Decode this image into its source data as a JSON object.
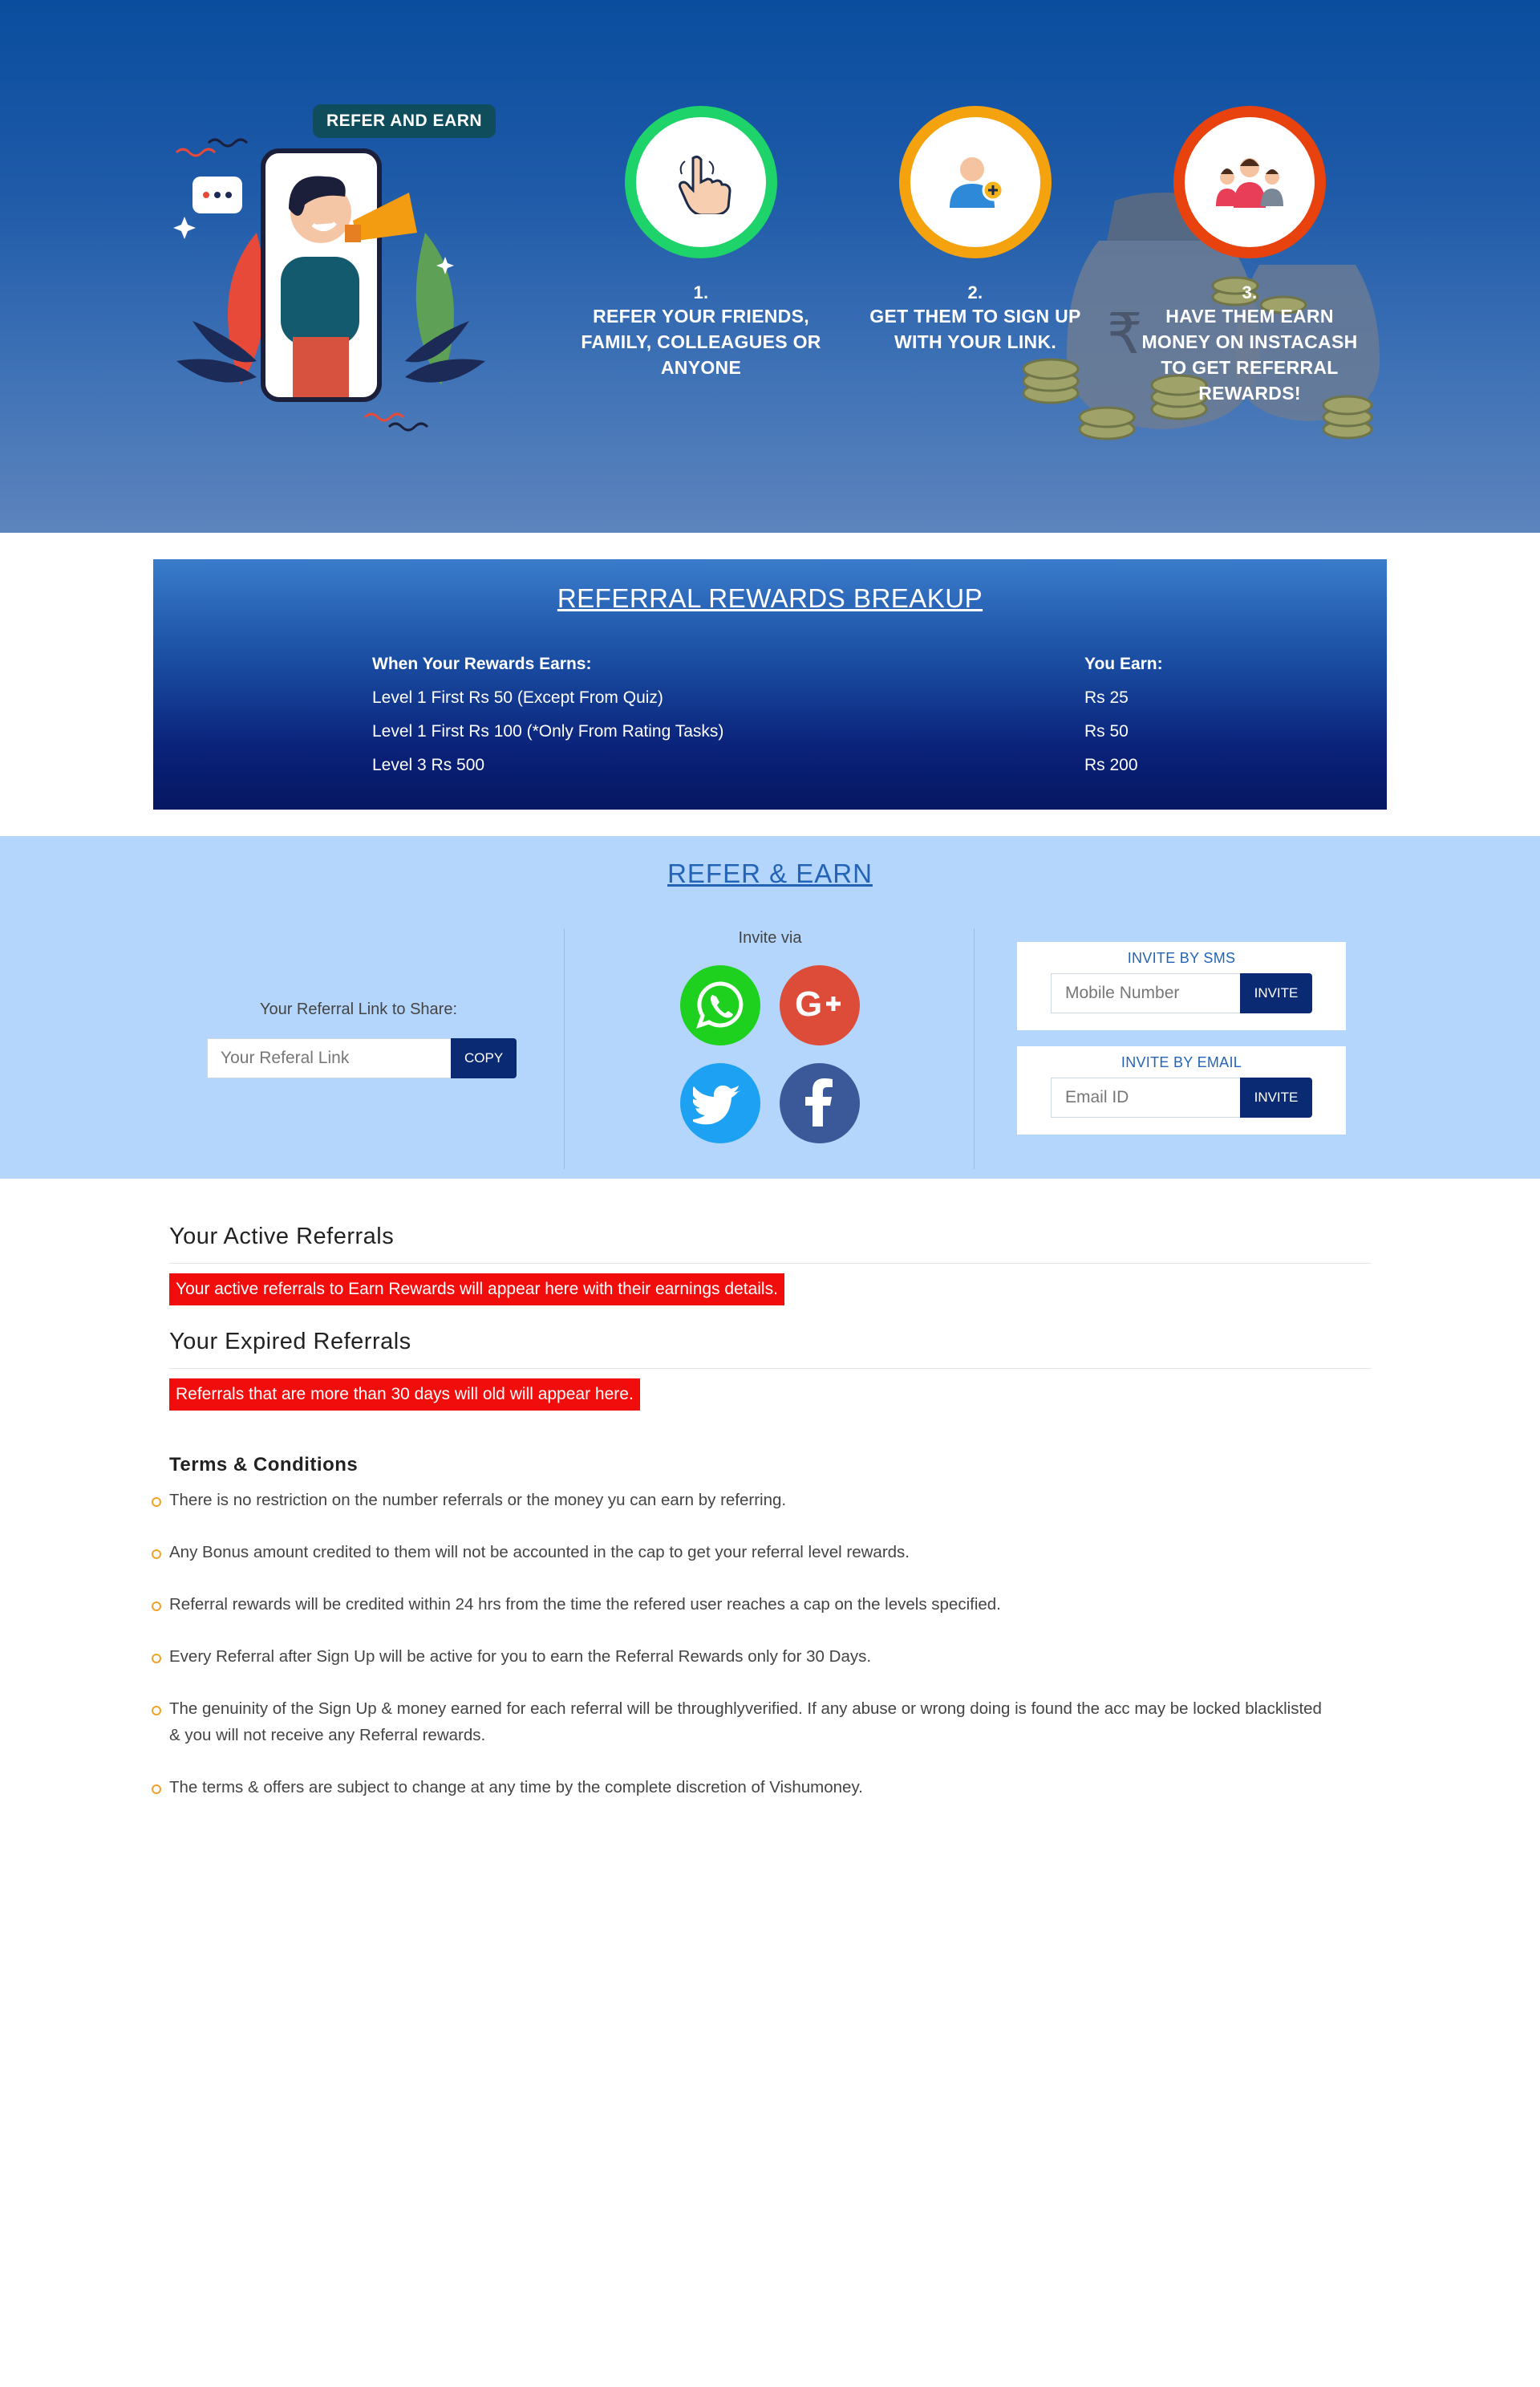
{
  "hero": {
    "tag": "REFER AND EARN",
    "steps": [
      {
        "num": "1.",
        "text": "REFER YOUR FRIENDS, FAMILY, COLLEAGUES OR ANYONE",
        "icon": "pointer-hand-icon"
      },
      {
        "num": "2.",
        "text": "GET THEM TO SIGN UP WITH YOUR LINK.",
        "icon": "add-user-icon"
      },
      {
        "num": "3.",
        "text": "HAVE THEM EARN MONEY ON INSTACASH TO GET REFERRAL REWARDS!",
        "icon": "group-icon"
      }
    ]
  },
  "breakup": {
    "title": "REFERRAL REWARDS BREAKUP",
    "col_condition": "When Your Rewards Earns:",
    "col_earn": "You Earn:",
    "rows": [
      {
        "condition": "Level 1 First Rs 50 (Except From Quiz)",
        "earn": "Rs 25"
      },
      {
        "condition": "Level 1 First Rs 100 (*Only From Rating Tasks)",
        "earn": "Rs 50"
      },
      {
        "condition": "Level 3 Rs 500",
        "earn": "Rs 200"
      }
    ]
  },
  "refer": {
    "title": "REFER & EARN",
    "link_label": "Your Referral Link to Share:",
    "link_placeholder": "Your Referal Link",
    "copy_label": "COPY",
    "invite_via": "Invite via",
    "social": [
      "whatsapp-icon",
      "google-plus-icon",
      "twitter-icon",
      "facebook-icon"
    ],
    "sms": {
      "title": "INVITE BY SMS",
      "placeholder": "Mobile Number",
      "button": "INVITE"
    },
    "email": {
      "title": "INVITE BY EMAIL",
      "placeholder": "Email ID",
      "button": "INVITE"
    }
  },
  "referrals": {
    "active_title": "Your Active Referrals",
    "active_note": "Your active referrals to Earn Rewards will appear here with their earnings details.",
    "expired_title": "Your Expired Referrals",
    "expired_note": "Referrals that are more than 30 days will old will appear here."
  },
  "terms": {
    "title": "Terms & Conditions",
    "items": [
      "There is no restriction on the number referrals or the money yu can earn by referring.",
      "Any Bonus amount credited to them will not be accounted in the cap to get your referral level rewards.",
      "Referral rewards will be credited within 24 hrs from the time the refered user reaches a cap on the levels specified.",
      "Every Referral after Sign Up will be active for you to earn the Referral Rewards only for 30 Days.",
      "The genuinity of the Sign Up & money earned for each referral will be throughlyverified. If any abuse or wrong doing is found the acc may be locked blacklisted & you will not receive any Referral rewards.",
      "The terms & offers are subject to change at any time by the complete discretion of Vishumoney."
    ]
  },
  "colors": {
    "hero_top": "#0a4d9e",
    "breakup_bottom": "#061762",
    "share_band": "#b5d6fc",
    "button_dark": "#0a2a73",
    "note_red": "#f20d0d",
    "accent_blue": "#2464b6",
    "bullet_orange": "#f0a328"
  }
}
